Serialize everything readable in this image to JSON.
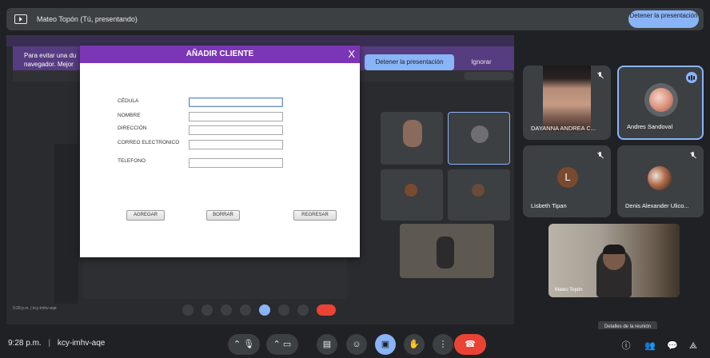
{
  "topbar": {
    "title": "Mateo Topón (Tú, presentando)",
    "stop_button": "Detener la presentación"
  },
  "shared_screen": {
    "banner_text": "Para evitar una du navegador. Mejor",
    "stop_button": "Detener la presentación",
    "ignore_button": "Ignorar"
  },
  "dialog": {
    "title": "AÑADIR CLIENTE",
    "close_glyph": "X",
    "fields": [
      {
        "label": "CÉDULA"
      },
      {
        "label": "NOMBRE"
      },
      {
        "label": "DIRECCIÓN"
      },
      {
        "label": "CORREO ELECTRONICO"
      },
      {
        "label": "TELEFONO"
      }
    ],
    "buttons": {
      "add": "AGREGAR",
      "clear": "BORRAR",
      "back": "REGRESAR"
    }
  },
  "participants": [
    {
      "name": "DAYANNA ANDREA C...",
      "mic": "muted"
    },
    {
      "name": "Andres Sandoval",
      "mic": "speaking"
    },
    {
      "name": "Lisbeth Tipan",
      "mic": "muted",
      "initial": "L"
    },
    {
      "name": "Denis Alexander Ulico...",
      "mic": "muted"
    },
    {
      "name": "Mateo Topón",
      "mic": "on"
    }
  ],
  "bottombar": {
    "time": "9:28 p.m.",
    "separator": "|",
    "meeting_code": "kcy-imhv-aqe",
    "tooltip": "Detalles de la reunión"
  },
  "colors": {
    "dialog_header": "#7b36b5",
    "accent_blue": "#8ab4f8",
    "end_call_red": "#ea4335",
    "surface": "#3c4043"
  }
}
